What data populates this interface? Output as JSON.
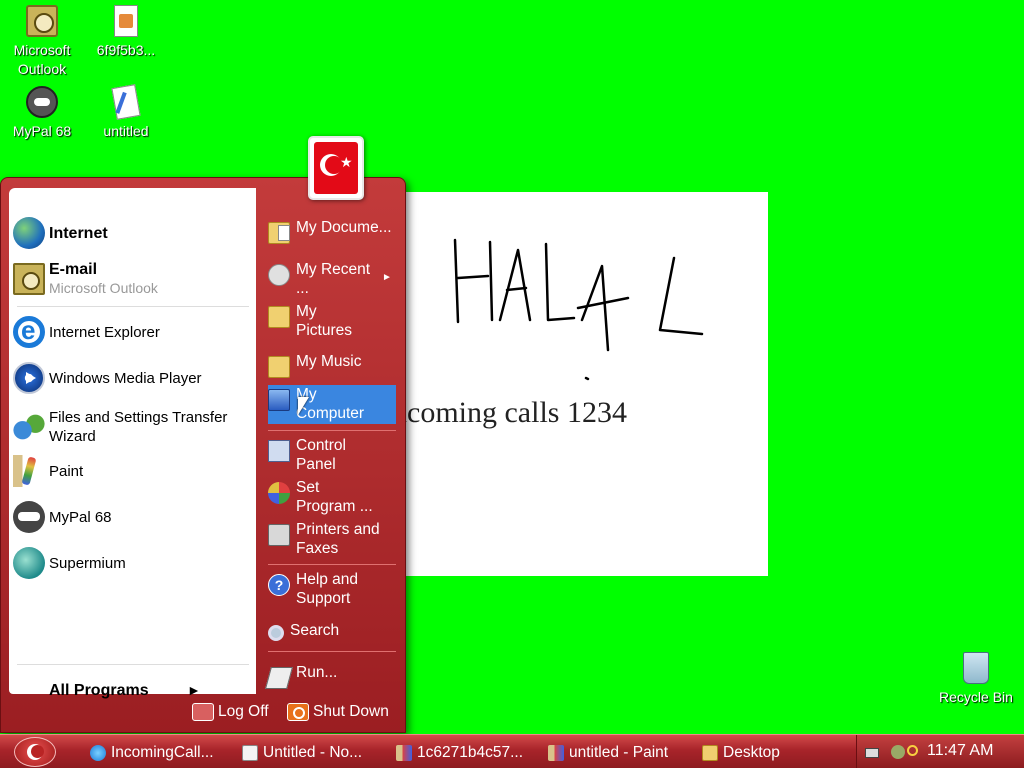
{
  "desktop": {
    "icons": [
      {
        "label": "Microsoft Outlook",
        "icon": "outlook-icon"
      },
      {
        "label": "6f9f5b3...",
        "icon": "file-icon"
      },
      {
        "label": "MyPal 68",
        "icon": "mypal-icon"
      },
      {
        "label": "untitled",
        "icon": "paint-document-icon"
      },
      {
        "label": "Recycle Bin",
        "icon": "recycle-bin-icon"
      }
    ]
  },
  "paint_canvas": {
    "handwriting": "HALAL",
    "typed_text": "ncoming calls 1234"
  },
  "start_menu": {
    "left": {
      "pinned": [
        {
          "label": "Internet",
          "icon": "globe-icon"
        },
        {
          "label": "E-mail",
          "sublabel": "Microsoft Outlook",
          "icon": "mail-icon"
        }
      ],
      "recent": [
        {
          "label": "Internet Explorer",
          "icon": "ie-icon"
        },
        {
          "label": "Windows Media Player",
          "icon": "media-player-icon"
        },
        {
          "label": "Files and Settings Transfer Wizard",
          "icon": "transfer-wizard-icon"
        },
        {
          "label": "Paint",
          "icon": "paint-icon"
        },
        {
          "label": "MyPal 68",
          "icon": "mypal-icon"
        },
        {
          "label": "Supermium",
          "icon": "supermium-icon"
        }
      ],
      "all_programs": "All Programs"
    },
    "right": [
      {
        "label": "My Docume...",
        "icon": "documents-folder-icon"
      },
      {
        "label": "My Recent ...",
        "icon": "recent-documents-icon"
      },
      {
        "label": "My Pictures",
        "icon": "pictures-folder-icon"
      },
      {
        "label": "My Music",
        "icon": "music-folder-icon"
      },
      {
        "label": "My Computer",
        "icon": "my-computer-icon",
        "highlighted": true
      },
      {
        "label": "Control Panel",
        "icon": "control-panel-icon"
      },
      {
        "label": "Set Program ...",
        "icon": "set-program-access-icon"
      },
      {
        "label": "Printers and Faxes",
        "icon": "printer-icon"
      },
      {
        "label": "Help and Support",
        "icon": "help-icon"
      },
      {
        "label": "Search",
        "icon": "search-icon"
      },
      {
        "label": "Run...",
        "icon": "run-icon"
      }
    ],
    "footer": {
      "logoff": "Log Off",
      "shutdown": "Shut Down"
    }
  },
  "taskbar": {
    "tasks": [
      {
        "label": "IncomingCall...",
        "icon": "browser-icon"
      },
      {
        "label": "Untitled - No...",
        "icon": "notepad-icon"
      },
      {
        "label": "1c6271b4c57...",
        "icon": "paint-icon"
      },
      {
        "label": "untitled - Paint",
        "icon": "paint-icon"
      },
      {
        "label": "Desktop",
        "icon": "folder-icon"
      }
    ],
    "clock": "11:47 AM"
  },
  "colors": {
    "desktop_background": "#00ff00",
    "theme_red": "#b02a2e",
    "highlight": "#3a86e0"
  }
}
